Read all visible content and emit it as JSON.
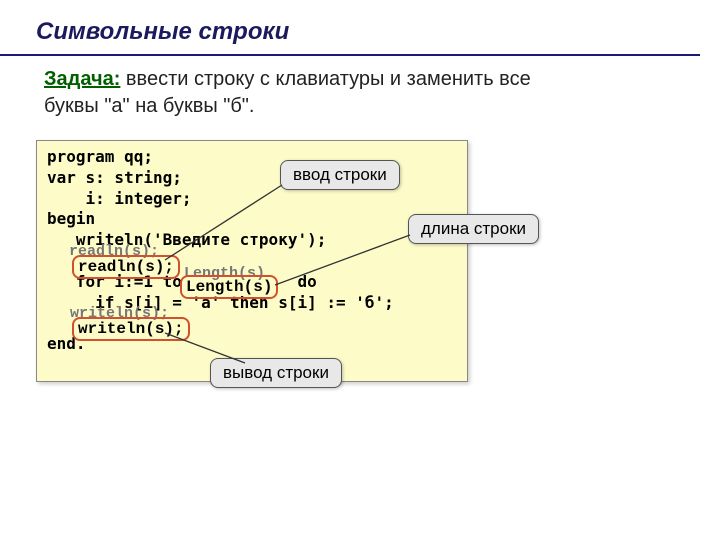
{
  "title": "Символьные строки",
  "task": {
    "label": "Задача:",
    "text1": " ввести строку с клавиатуры и заменить все",
    "text2": "буквы \"а\" на буквы \"б\"."
  },
  "code": {
    "line1": "program qq;",
    "line2": "var s: string;",
    "line3": "    i: integer;",
    "line4": "begin",
    "line5": "   writeln('Введите строку');",
    "line6": "   ",
    "line7": "   for i:=1 to            do",
    "line8": "     if s[i] = 'а' then s[i] := 'б';",
    "line9": "   ",
    "line10": "end."
  },
  "highlights": {
    "readln_shadow": "readln(s);",
    "readln": "readln(s);",
    "length_shadow": "Length(s)",
    "length": "Length(s)",
    "writeln_shadow": "writeln(s);",
    "writeln": "writeln(s);"
  },
  "callouts": {
    "input": "ввод строки",
    "length": "длина строки",
    "output": "вывод строки"
  }
}
